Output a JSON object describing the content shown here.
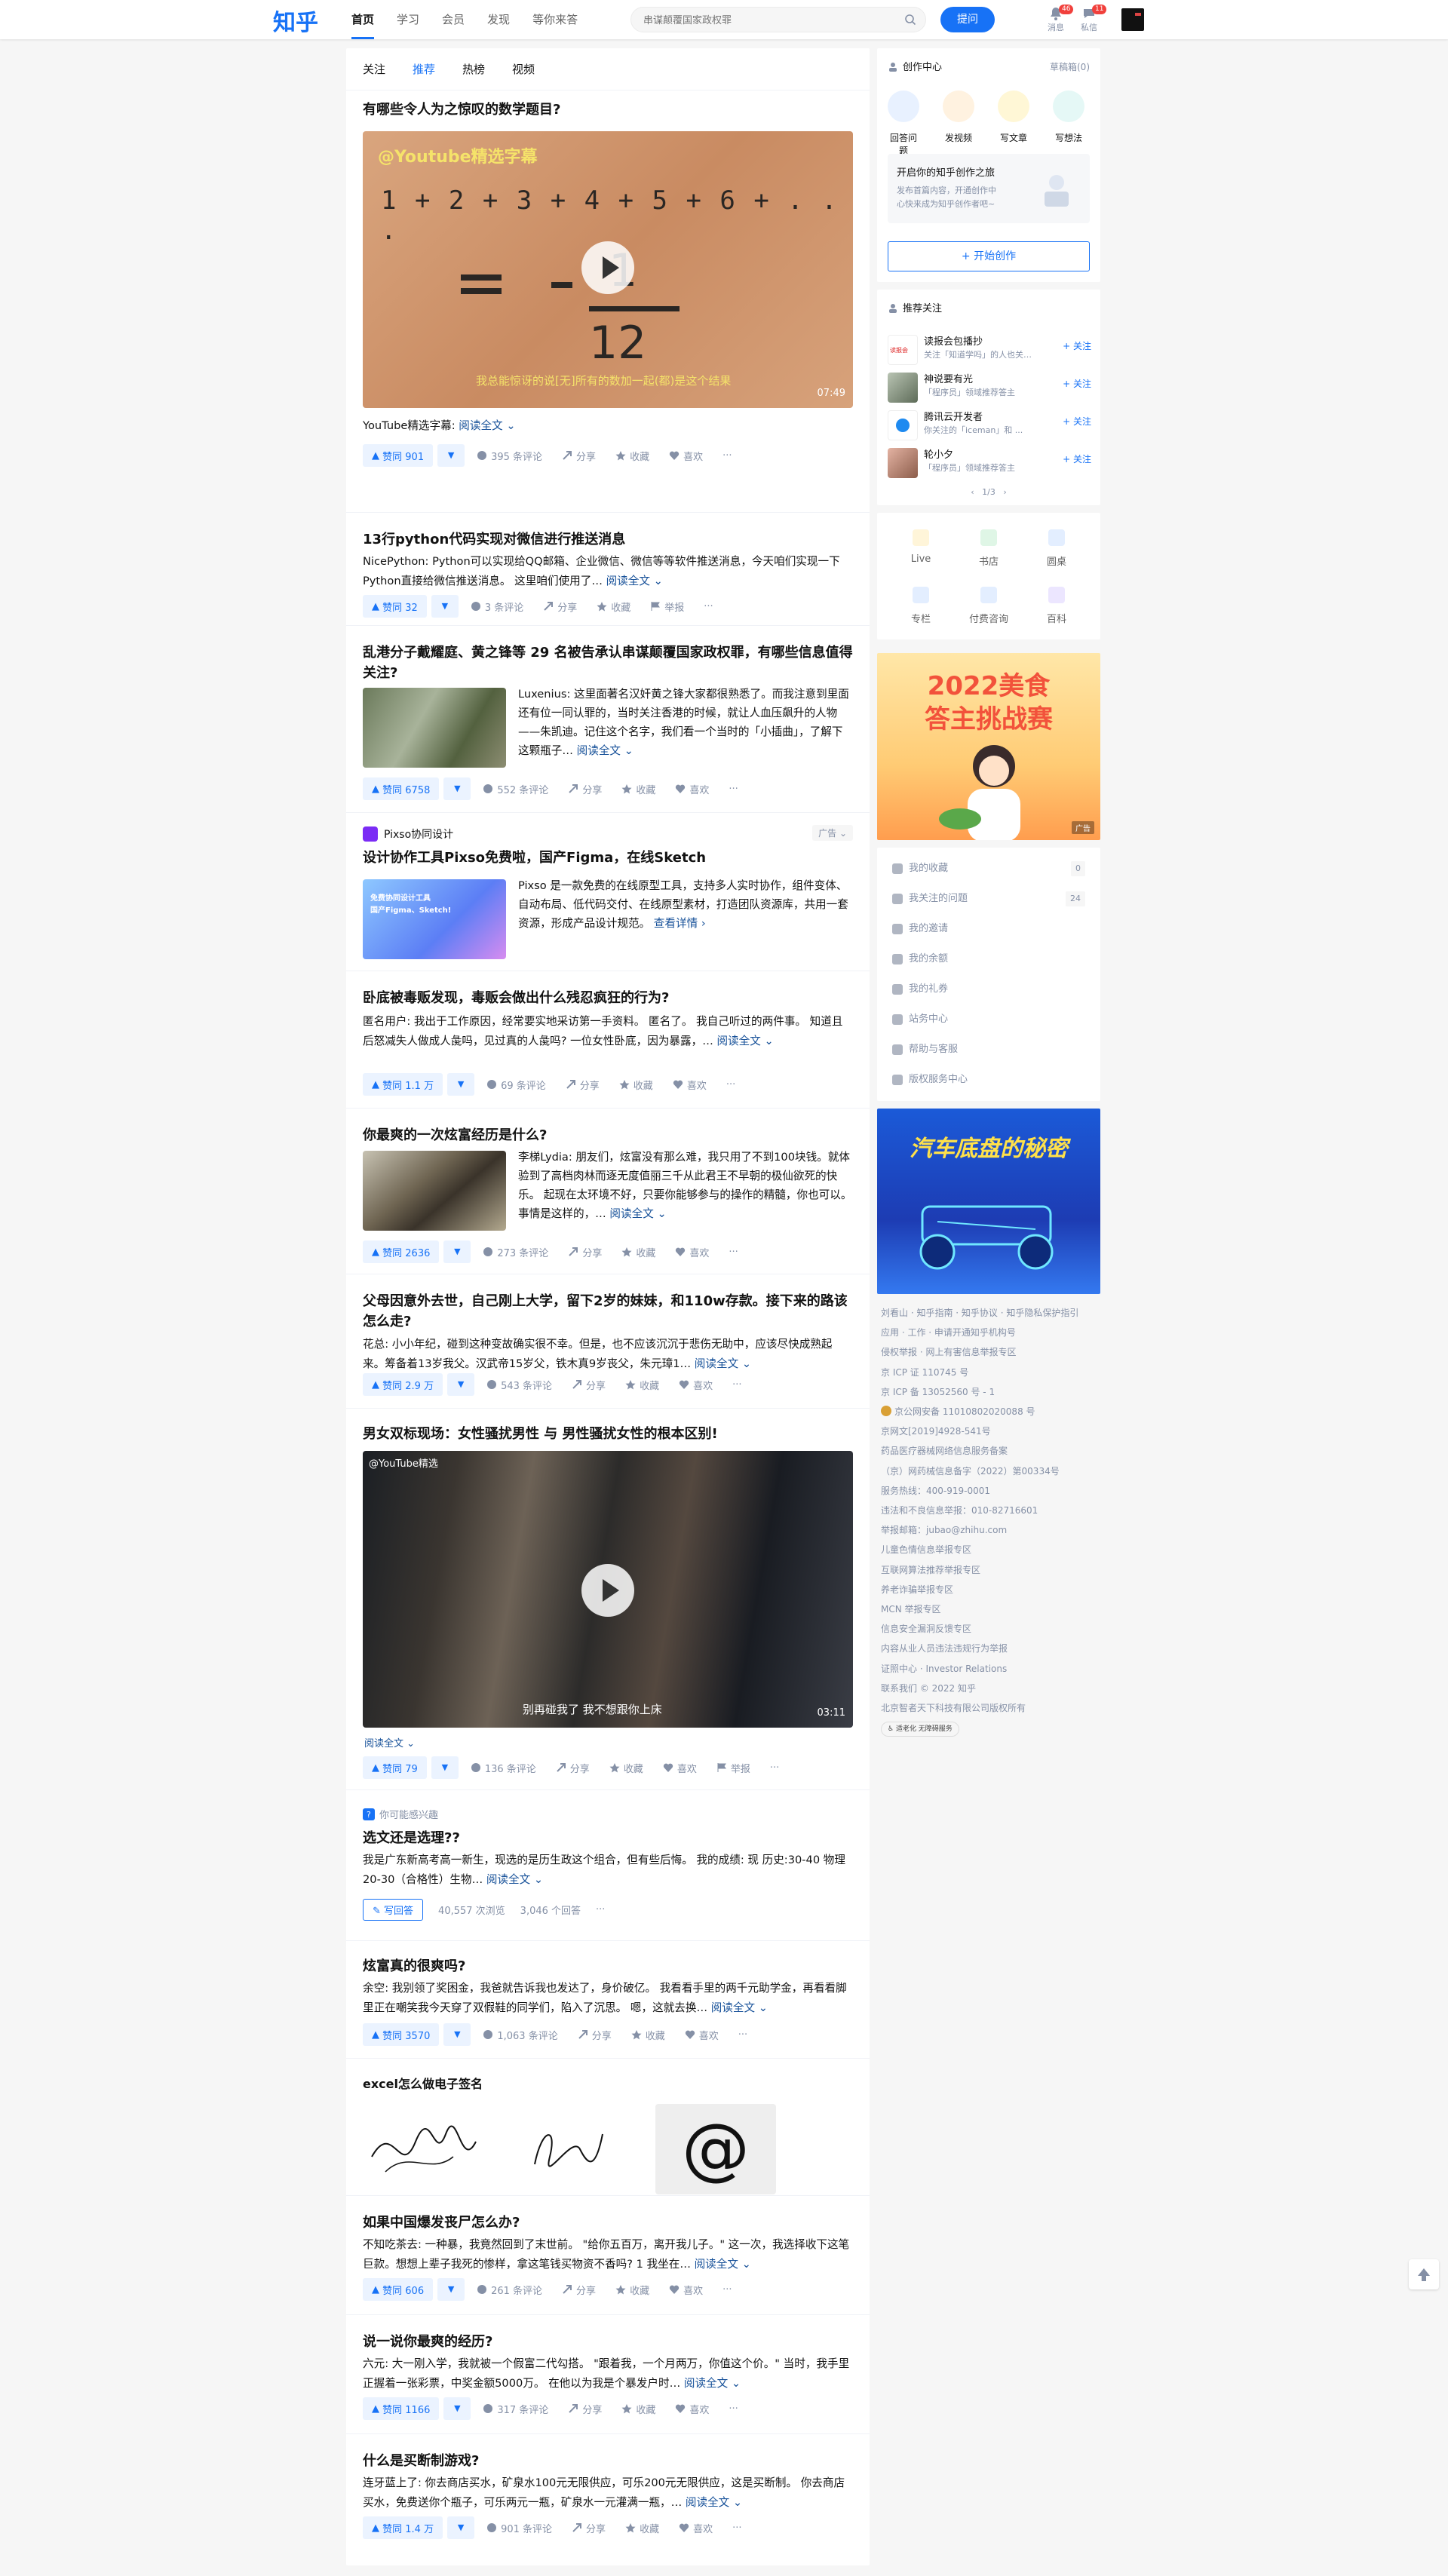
{
  "header": {
    "logo": "知乎",
    "nav": [
      "首页",
      "学习",
      "会员",
      "发现",
      "等你来答"
    ],
    "search_placeholder": "串谋颠覆国家政权罪",
    "ask_button": "提问",
    "messages_label": "消息",
    "messages_badge": "46",
    "dm_label": "私信",
    "dm_badge": "11"
  },
  "tabs": [
    "关注",
    "推荐",
    "热榜",
    "视频"
  ],
  "feed": [
    {
      "title": "有哪些令人为之惊叹的数学题目?",
      "video_watermark": "@Youtube精选字幕",
      "video_formula": "1 + 2 + 3 + 4 + 5 + 6 + . . .",
      "video_result_num": "1",
      "video_result_den": "12",
      "video_subtitle": "我总能惊讶的说[无]所有的数加一起(都)是这个结果",
      "duration": "07:49",
      "excerpt": "YouTube精选字幕:",
      "more": "阅读全文",
      "votes": "赞同 901",
      "comments": "395 条评论",
      "share": "分享",
      "fav": "收藏",
      "like": "喜欢"
    },
    {
      "title": "13行python代码实现对微信进行推送消息",
      "excerpt": "NicePython:  Python可以实现给QQ邮箱、企业微信、微信等等软件推送消息，今天咱们实现一下Python直接给微信推送消息。 这里咱们使用了…",
      "more": "阅读全文",
      "votes": "赞同 32",
      "comments": "3 条评论",
      "share": "分享",
      "fav": "收藏",
      "report": "举报"
    },
    {
      "title": "乱港分子戴耀庭、黄之锋等 29 名被告承认串谋颠覆国家政权罪，有哪些信息值得关注?",
      "excerpt": "Luxenius:  这里面著名汉奸黄之锋大家都很熟悉了。而我注意到里面还有位一同认罪的，当时关注香港的时候，就让人血压飙升的人物——朱凯迪。记住这个名字，我们看一个当时的「小插曲」，了解下这颗瓶子…",
      "more": "阅读全文",
      "votes": "赞同 6758",
      "comments": "552 条评论",
      "share": "分享",
      "fav": "收藏",
      "like": "喜欢"
    },
    {
      "ad_brand": "Pixso协同设计",
      "ad_tag": "广告",
      "title": "设计协作工具Pixso免费啦，国产Figma，在线Sketch",
      "excerpt": "Pixso 是一款免费的在线原型工具，支持多人实时协作，组件变体、自动布局、低代码交付、在线原型素材，打造团队资源库，共用一套资源，形成产品设计规范。",
      "more": "查看详情",
      "ad_image_line1": "免费协同设计工具",
      "ad_image_line2": "国产Figma、Sketch!"
    },
    {
      "title": "卧底被毒贩发现，毒贩会做出什么残忍疯狂的行为?",
      "excerpt": "匿名用户:  我出于工作原因，经常要实地采访第一手资料。 匿名了。 我自己听过的两件事。 知道且后怒减失人做成人彘吗，见过真的人彘吗? 一位女性卧底，因为暴露，…",
      "more": "阅读全文",
      "votes": "赞同 1.1 万",
      "comments": "69 条评论",
      "share": "分享",
      "fav": "收藏",
      "like": "喜欢"
    },
    {
      "title": "你最爽的一次炫富经历是什么?",
      "excerpt": "李梯Lydia:  朋友们，炫富没有那么难，我只用了不到100块钱。就体验到了高档肉林而逐无度值丽三千从此君王不早朝的极仙欲死的快乐。 起现在太环境不好，只要你能够参与的操作的精髓，你也可以。 事情是这样的，…",
      "more": "阅读全文",
      "votes": "赞同 2636",
      "comments": "273 条评论",
      "share": "分享",
      "fav": "收藏",
      "like": "喜欢"
    },
    {
      "title": "父母因意外去世，自己刚上大学，留下2岁的妹妹，和110w存款。接下来的路该怎么走?",
      "excerpt": "花总:  小小年纪，碰到这种变故确实很不幸。但是，也不应该沉沉于悲伤无助中，应该尽快成熟起来。筹备着13岁我父。汉武帝15岁父，铁木真9岁丧父，朱元璋1…",
      "more": "阅读全文",
      "votes": "赞同 2.9 万",
      "comments": "543 条评论",
      "share": "分享",
      "fav": "收藏",
      "like": "喜欢"
    },
    {
      "title": "男女双标现场：女性骚扰男性 与 男性骚扰女性的根本区别!",
      "video_watermark": "@YouTube精选",
      "video_subtitle": "别再碰我了 我不想跟你上床",
      "duration": "03:11",
      "more": "阅读全文",
      "votes": "赞同 79",
      "comments": "136 条评论",
      "share": "分享",
      "fav": "收藏",
      "like": "喜欢",
      "report": "举报"
    },
    {
      "tag": "你可能感兴趣",
      "title": "选文还是选理??",
      "excerpt": "我是广东新高考高一新生，现选的是历生政这个组合，但有些后悔。 我的成绩: 现 历史:30-40 物理20-30（合格性）生物…",
      "more": "阅读全文",
      "write_answer": "写回答",
      "views": "40,557 次浏览",
      "answers": "3,046 个回答"
    },
    {
      "title": "炫富真的很爽吗?",
      "excerpt": "余空:  我别领了奖困金，我爸就告诉我也发达了，身价破亿。 我看看手里的两千元助学金，再看看脚里正在嘲笑我今天穿了双假鞋的同学们，陷入了沉思。 嗯，这就去换…",
      "more": "阅读全文",
      "votes": "赞同 3570",
      "comments": "1,063 条评论",
      "share": "分享",
      "fav": "收藏",
      "like": "喜欢"
    },
    {
      "title": "excel怎么做电子签名",
      "at_symbol": "@"
    },
    {
      "title": "如果中国爆发丧尸怎么办?",
      "excerpt": "不知吃茶去:  一种暴，我竟然回到了末世前。 \"给你五百万，离开我儿子。\" 这一次，我选择收下这笔巨款。想想上辈子我死的惨样，拿这笔钱买物资不香吗? 1 我坐在…",
      "more": "阅读全文",
      "votes": "赞同 606",
      "comments": "261 条评论",
      "share": "分享",
      "fav": "收藏",
      "like": "喜欢"
    },
    {
      "title": "说一说你最爽的经历?",
      "excerpt": "六元:  大一刚入学，我就被一个假富二代勾搭。 \"跟着我，一个月两万，你值这个价。\" 当时，我手里正握着一张彩票，中奖金额5000万。 在他以为我是个暴发户时…",
      "more": "阅读全文",
      "votes": "赞同 1166",
      "comments": "317 条评论",
      "share": "分享",
      "fav": "收藏",
      "like": "喜欢"
    },
    {
      "title": "什么是买断制游戏?",
      "excerpt": "连牙蓝上了:  你去商店买水，矿泉水100元无限供应，可乐200元无限供应，这是买断制。 你去商店买水，免费送你个瓶子，可乐两元一瓶，矿泉水一元灌满一瓶，…",
      "more": "阅读全文",
      "votes": "赞同 1.4 万",
      "comments": "901 条评论",
      "share": "分享",
      "fav": "收藏",
      "like": "喜欢"
    }
  ],
  "sidebar": {
    "creator_title": "创作中心",
    "creator_link": "草稿箱(0)",
    "creator_items": [
      "回答问题",
      "发视频",
      "写文章",
      "写想法"
    ],
    "creator_banner_title": "开启你的知乎创作之旅",
    "creator_banner_desc": "发布首篇内容，开通创作中心快来成为知乎创作者吧~",
    "start_button": "开始创作",
    "recommend_title": "推荐关注",
    "recommend": [
      {
        "name": "读报会包播抄",
        "desc": "关注「知道学吗」的人也关…",
        "follow": "关注"
      },
      {
        "name": "神说要有光",
        "desc": "「程序员」领域推荐答主",
        "follow": "关注"
      },
      {
        "name": "腾讯云开发者",
        "desc": "你关注的「iceman」和 ...",
        "follow": "关注"
      },
      {
        "name": "轮小夕",
        "desc": "「程序员」领域推荐答主",
        "follow": "关注"
      }
    ],
    "recommend_page": "1/3",
    "grid": [
      "Live",
      "书店",
      "圆桌",
      "专栏",
      "付费咨询",
      "百科"
    ],
    "promo1_line1": "2022美食",
    "promo1_line2": "答主挑战赛",
    "promo1_tag": "广告",
    "menu": [
      {
        "label": "我的收藏",
        "count": "0"
      },
      {
        "label": "我关注的问题",
        "count": "24"
      },
      {
        "label": "我的邀请"
      },
      {
        "label": "我的余额"
      },
      {
        "label": "我的礼券"
      },
      {
        "label": "站务中心"
      },
      {
        "label": "帮助与客服"
      },
      {
        "label": "版权服务中心"
      }
    ],
    "promo2_title": "汽车底盘的秘密",
    "footer": [
      "刘看山 · 知乎指南 · 知乎协议 · 知乎隐私保护指引",
      "应用 · 工作 · 申请开通知乎机构号",
      "侵权举报 · 网上有害信息举报专区",
      "京 ICP 证 110745 号",
      "京 ICP 备 13052560 号 - 1",
      "京公网安备 11010802020088 号",
      "京网文[2019]4928-541号",
      "药品医疗器械网络信息服务备案",
      "（京）网药械信息备字（2022）第00334号",
      "服务热线：400-919-0001",
      "违法和不良信息举报：010-82716601",
      "举报邮箱：jubao@zhihu.com",
      "儿童色情信息举报专区",
      "互联网算法推荐举报专区",
      "养老诈骗举报专区",
      "MCN 举报专区",
      "信息安全漏洞反馈专区",
      "内容从业人员违法违规行为举报",
      "证照中心 · Investor Relations",
      "联系我们 © 2022 知乎",
      "北京智者天下科技有限公司版权所有"
    ],
    "accessibility": "适老化 无障碍服务"
  },
  "colors": {
    "brand": "#1772f6",
    "text": "#121212",
    "muted": "#8590a6",
    "link": "#175199",
    "bg": "#f6f6f6"
  }
}
